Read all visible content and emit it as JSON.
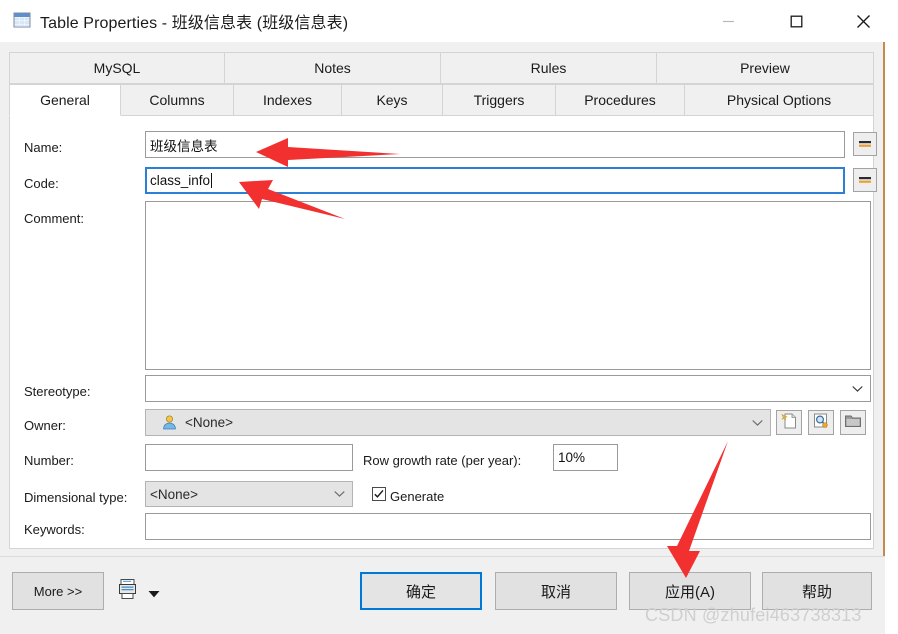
{
  "window": {
    "title": "Table Properties - 班级信息表 (班级信息表)",
    "icon": "table-icon",
    "controls": {
      "minimize": "minimize-icon",
      "maximize": "maximize-icon",
      "close": "close-icon"
    }
  },
  "tabs": {
    "top_row": [
      {
        "label": "MySQL"
      },
      {
        "label": "Notes"
      },
      {
        "label": "Rules"
      },
      {
        "label": "Preview"
      }
    ],
    "bottom_row": [
      {
        "label": "General",
        "active": true
      },
      {
        "label": "Columns"
      },
      {
        "label": "Indexes"
      },
      {
        "label": "Keys"
      },
      {
        "label": "Triggers"
      },
      {
        "label": "Procedures"
      },
      {
        "label": "Physical Options"
      }
    ]
  },
  "form": {
    "name": {
      "label": "Name:",
      "value": "班级信息表",
      "equals_button": "equals-icon"
    },
    "code": {
      "label": "Code:",
      "value": "class_info",
      "focused": true,
      "equals_button": "equals-icon"
    },
    "comment": {
      "label": "Comment:",
      "value": ""
    },
    "stereotype": {
      "label": "Stereotype:",
      "value": ""
    },
    "owner": {
      "label": "Owner:",
      "value": "<None>",
      "icon": "user-icon",
      "side_buttons": [
        "new-object-icon",
        "browse-object-icon",
        "open-object-icon"
      ]
    },
    "number": {
      "label": "Number:",
      "value": ""
    },
    "row_growth": {
      "label": "Row growth rate (per year):",
      "value": "10%"
    },
    "dimensional_type": {
      "label": "Dimensional type:",
      "value": "<None>"
    },
    "generate": {
      "label": "Generate",
      "checked": true
    },
    "keywords": {
      "label": "Keywords:",
      "value": ""
    }
  },
  "footer": {
    "more_button": "More >>",
    "print_icon": "print-report-icon",
    "print_dropdown": "chevron-down-icon",
    "ok_button": "确定",
    "cancel_button": "取消",
    "apply_button": "应用(A)",
    "help_button": "帮助",
    "watermark": "CSDN @zhufei463738313"
  },
  "colors": {
    "accent": "#0078d7",
    "annotation": "#f03030",
    "frame_border": "#c88a4a"
  }
}
